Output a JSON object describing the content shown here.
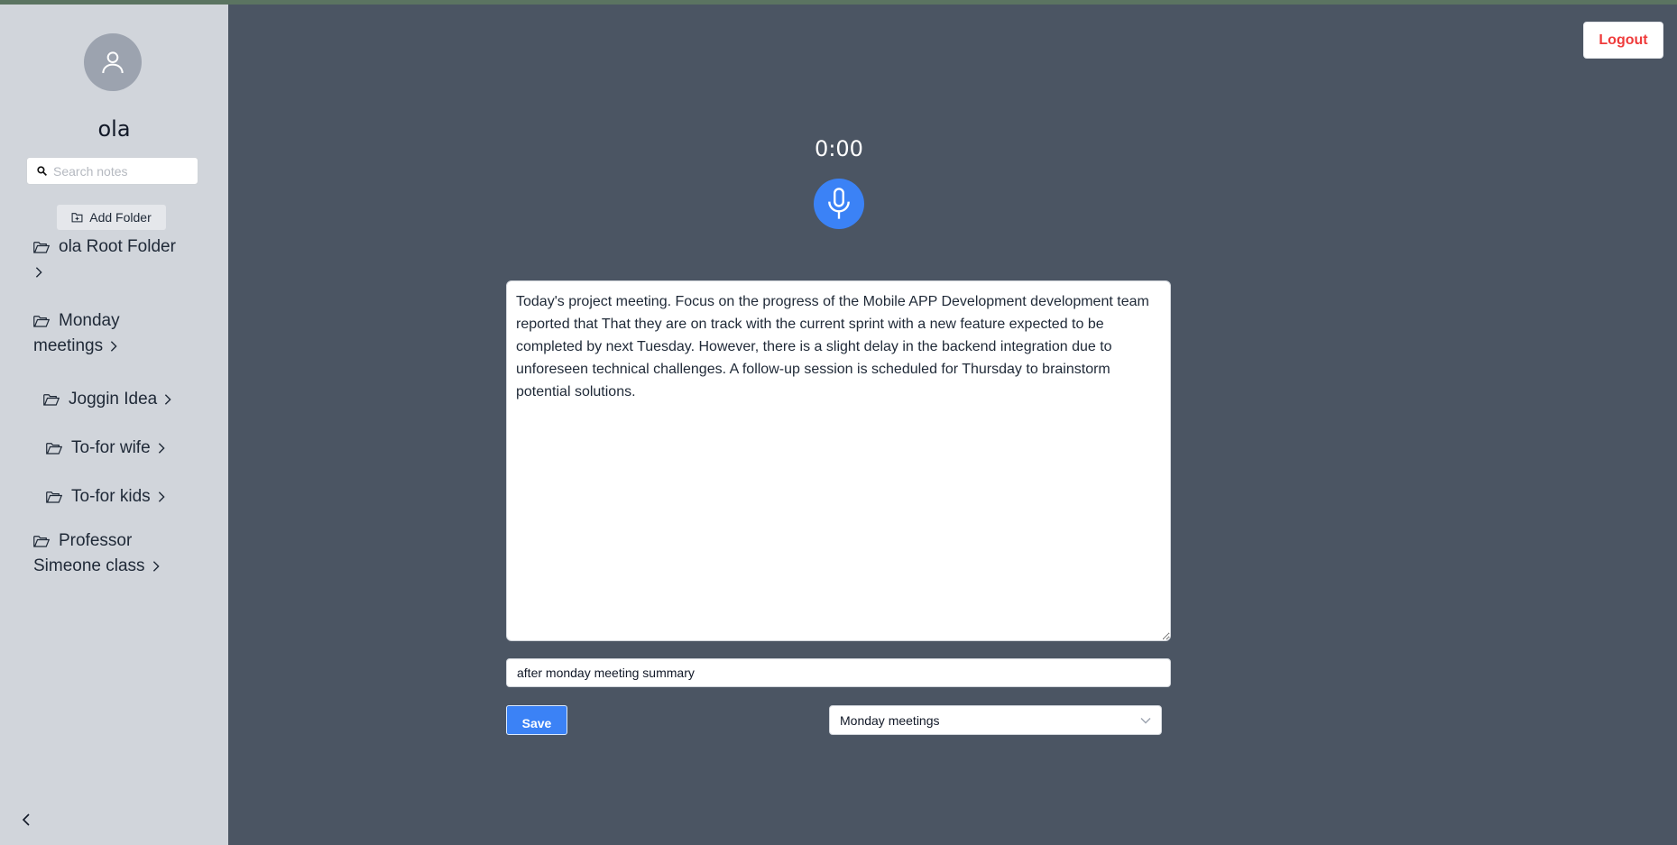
{
  "sidebar": {
    "username": "ola",
    "search_placeholder": "Search notes",
    "add_folder_label": "Add Folder",
    "folders": [
      {
        "name": "ola Root Folder"
      },
      {
        "name": "Monday meetings"
      },
      {
        "name": "Joggin Idea"
      },
      {
        "name": "To-for wife"
      },
      {
        "name": "To-for kids"
      },
      {
        "name": "Professor Simeone class"
      }
    ]
  },
  "header": {
    "logout_label": "Logout"
  },
  "recorder": {
    "timer": "0:00"
  },
  "note": {
    "body": "Today's project meeting. Focus on the progress of the Mobile APP Development development team reported that That they are on track with the current sprint with a new feature expected to be completed by next Tuesday. However, there is a slight delay in the backend integration due to unforeseen technical challenges. A follow-up session is scheduled for Thursday to brainstorm potential solutions.",
    "title": "after monday meeting summary",
    "save_label": "Save",
    "folder_select": "Monday meetings"
  },
  "colors": {
    "background": "#4b5563",
    "sidebar": "#d1d5db",
    "accent": "#3b82f6",
    "logout_text": "#ef3b3b"
  },
  "icons": {
    "avatar": "user-icon",
    "search": "search-icon",
    "add_folder": "folder-plus-icon",
    "folder": "folder-open-icon",
    "chevron": "chevron-right-icon",
    "collapse": "chevron-left-icon",
    "mic": "microphone-icon",
    "select": "chevron-down-icon"
  }
}
